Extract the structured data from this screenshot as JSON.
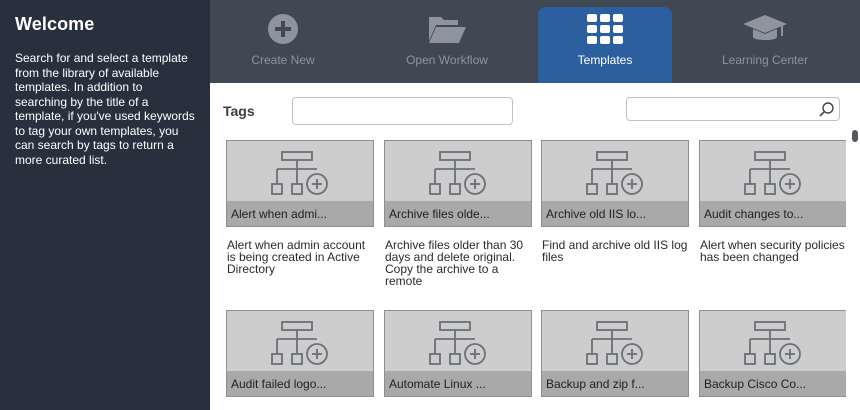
{
  "sidebar": {
    "title": "Welcome",
    "description": "Search for and select a template from the library of available templates. In addition to searching by the title of a template, if you've used keywords to tag your own templates, you can search by tags to return a more curated list."
  },
  "nav": {
    "tabs": [
      {
        "label": "Create New",
        "icon": "plus-circle-icon"
      },
      {
        "label": "Open Workflow",
        "icon": "folder-open-icon"
      },
      {
        "label": "Templates",
        "icon": "grid-icon",
        "active": true
      },
      {
        "label": "Learning Center",
        "icon": "graduation-cap-icon"
      }
    ]
  },
  "filters": {
    "tags_label": "Tags",
    "tags_value": "",
    "search_value": ""
  },
  "templates": [
    {
      "title": "Alert when admi...",
      "description": "Alert when admin account is being created in Active Directory"
    },
    {
      "title": "Archive files olde...",
      "description": "Archive files older than 30 days and delete original. Copy the archive to a remote"
    },
    {
      "title": "Archive old IIS lo...",
      "description": "Find and archive old IIS log files"
    },
    {
      "title": "Audit changes to...",
      "description": "Alert when security policies has been changed"
    },
    {
      "title": "Audit failed logo...",
      "description": ""
    },
    {
      "title": "Automate Linux ...",
      "description": ""
    },
    {
      "title": "Backup and zip f...",
      "description": ""
    },
    {
      "title": "Backup Cisco Co...",
      "description": ""
    }
  ],
  "colors": {
    "sidebar_bg": "#27313e",
    "nav_bg": "#404853",
    "active_tab": "#2b5f9e"
  }
}
